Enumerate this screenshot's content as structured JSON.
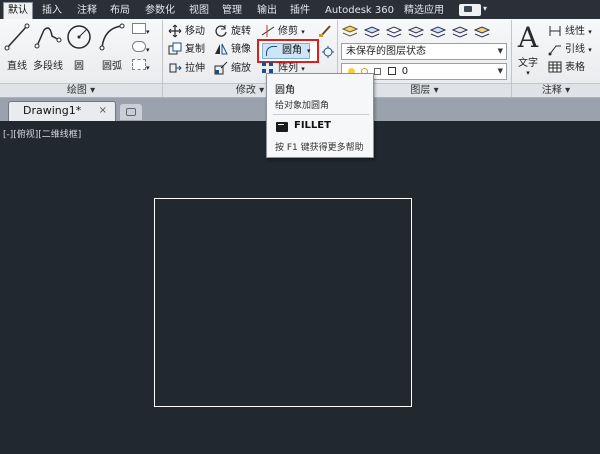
{
  "tabs": [
    {
      "label": "默认",
      "active": true
    },
    {
      "label": "插入"
    },
    {
      "label": "注释"
    },
    {
      "label": "布局"
    },
    {
      "label": "参数化"
    },
    {
      "label": "视图"
    },
    {
      "label": "管理"
    },
    {
      "label": "输出"
    },
    {
      "label": "插件"
    },
    {
      "label": "Autodesk 360"
    },
    {
      "label": "精选应用"
    }
  ],
  "ribbon": {
    "draw": {
      "panel_label": "绘图 ▾",
      "line": "直线",
      "polyline": "多段线",
      "circle": "圆",
      "arc": "圆弧"
    },
    "modify": {
      "panel_label": "修改 ▾",
      "move": "移动",
      "rotate": "旋转",
      "trim": "修剪",
      "copy": "复制",
      "mirror": "镜像",
      "fillet": "圆角",
      "stretch": "拉伸",
      "scale": "缩放",
      "array": "阵列"
    },
    "layers": {
      "panel_label": "图层 ▾",
      "state_value": "未保存的图层状态",
      "current_layer": "0"
    },
    "annotation": {
      "panel_label": "注释 ▾",
      "text": "文字",
      "linear": "线性",
      "leader": "引线",
      "table": "表格"
    }
  },
  "file_tab": {
    "name": "Drawing1*",
    "close": "×"
  },
  "viewport_label": "[-][俯视][二维线框]",
  "tooltip": {
    "title": "圆角",
    "description": "给对象加圆角",
    "command": "FILLET",
    "help": "按 F1 键获得更多帮助"
  },
  "colors": {
    "canvas": "#212830",
    "highlight": "#e01d1d",
    "selected_button": "#cde5f7"
  }
}
